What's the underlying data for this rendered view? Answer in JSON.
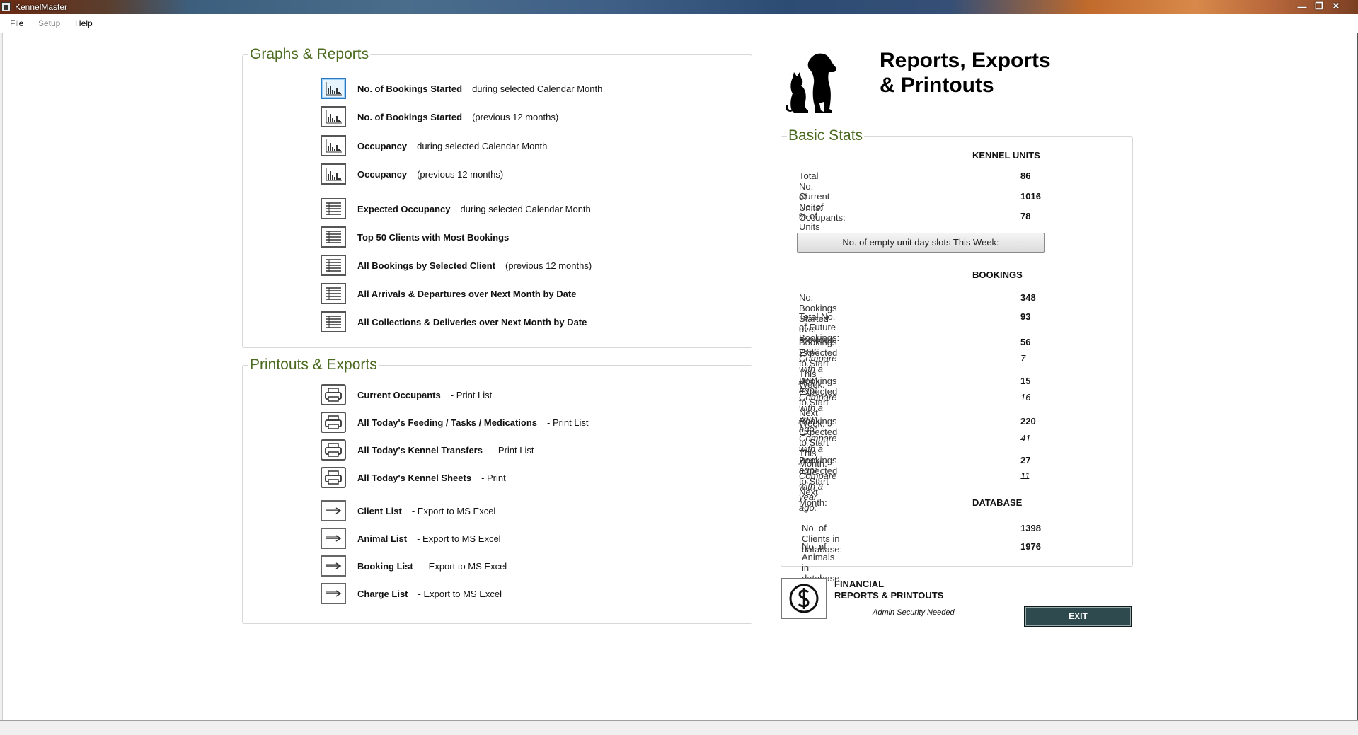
{
  "window": {
    "title": "KennelMaster",
    "controls": [
      "minimize",
      "restore",
      "close"
    ]
  },
  "menu": {
    "file": "File",
    "setup": "Setup",
    "help": "Help"
  },
  "graphs_reports": {
    "legend": "Graphs & Reports",
    "items": [
      {
        "bold": "No. of Bookings Started",
        "note": "during selected Calendar Month",
        "icon": "bar-chart-icon"
      },
      {
        "bold": "No. of Bookings Started",
        "note": "(previous 12 months)",
        "icon": "bar-chart-icon"
      },
      {
        "bold": "Occupancy",
        "note": "during selected Calendar Month",
        "icon": "bar-chart-icon"
      },
      {
        "bold": "Occupancy",
        "note": "(previous 12 months)",
        "icon": "bar-chart-icon"
      },
      {
        "bold": "Expected Occupancy",
        "note": "during selected Calendar Month",
        "icon": "table-icon"
      },
      {
        "bold": "Top 50 Clients with Most Bookings",
        "note": "",
        "icon": "table-icon"
      },
      {
        "bold": "All Bookings by Selected Client",
        "note": "(previous 12 months)",
        "icon": "table-icon"
      },
      {
        "bold": "All Arrivals & Departures over Next Month by Date",
        "note": "",
        "icon": "table-icon"
      },
      {
        "bold": "All Collections & Deliveries over Next Month by Date",
        "note": "",
        "icon": "table-icon"
      }
    ]
  },
  "printouts_exports": {
    "legend": "Printouts & Exports",
    "items": [
      {
        "bold": "Current Occupants",
        "note": "- Print List",
        "icon": "printer-icon"
      },
      {
        "bold": "All Today's Feeding / Tasks / Medications",
        "note": "- Print List",
        "icon": "printer-icon"
      },
      {
        "bold": "All Today's Kennel Transfers",
        "note": "- Print List",
        "icon": "printer-icon"
      },
      {
        "bold": "All Today's Kennel Sheets",
        "note": "- Print",
        "icon": "printer-icon"
      },
      {
        "bold": "Client List",
        "note": "- Export to MS Excel",
        "icon": "arrow-right-icon"
      },
      {
        "bold": "Animal List",
        "note": "- Export to MS Excel",
        "icon": "arrow-right-icon"
      },
      {
        "bold": "Booking List",
        "note": "- Export to MS Excel",
        "icon": "arrow-right-icon"
      },
      {
        "bold": "Charge List",
        "note": "- Export to MS Excel",
        "icon": "arrow-right-icon"
      }
    ]
  },
  "heading": {
    "line1": "Reports, Exports",
    "line2": "& Printouts",
    "icon": "dog-cat-icon"
  },
  "basic_stats": {
    "legend": "Basic Stats",
    "kennel_units": {
      "title": "KENNEL UNITS",
      "total_units_label": "Total No. of Units:",
      "total_units": "86",
      "occupants_label": "Current No. of Occupants:",
      "occupants": "1016",
      "pct_label": "% of Units Occupied:",
      "pct": "78",
      "empty_slots_button": "No. of empty unit day slots This Week:",
      "empty_slots": "-"
    },
    "bookings": {
      "title": "BOOKINGS",
      "started_prev_year_label": "No. Bookings Started over previous year:",
      "started_prev_year": "348",
      "future_label": "Total No. of Future Bookings:",
      "future": "93",
      "this_week_label": "Bookings Expected to Start This Week:",
      "this_week": "56",
      "this_week_cmp_label": "Compare with a year ago:",
      "this_week_cmp": "7",
      "next_week_label": "Bookings Expected to Start Next Week:",
      "next_week": "15",
      "next_week_cmp_label": "Compare with a year ago:",
      "next_week_cmp": "16",
      "this_month_label": "Bookings Expected to Start This Month:",
      "this_month": "220",
      "this_month_cmp_label": "Compare with a year ago:",
      "this_month_cmp": "41",
      "next_month_label": "Bookings Expected to Start Next Month:",
      "next_month": "27",
      "next_month_cmp_label": "Compare with a year ago:",
      "next_month_cmp": "11"
    },
    "database": {
      "title": "DATABASE",
      "clients_label": "No. of Clients in database:",
      "clients": "1398",
      "animals_label": "No. of Animals in database:",
      "animals": "1976"
    }
  },
  "financial": {
    "line1": "FINANCIAL",
    "line2": "REPORTS & PRINTOUTS",
    "note": "Admin Security Needed",
    "icon": "dollar-icon"
  },
  "exit_label": "EXIT",
  "colors": {
    "legend_green": "#4a6a1f",
    "exit_bg": "#2e4a4e",
    "selected_icon": "#2b7ac1"
  }
}
